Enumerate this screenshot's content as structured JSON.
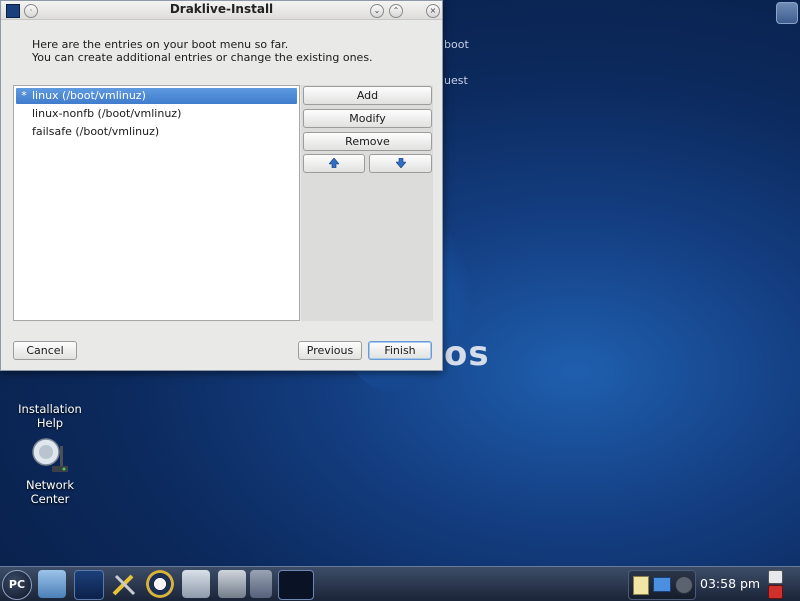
{
  "window": {
    "title": "Draklive-Install",
    "intro_line1": "Here are the entries on your boot menu so far.",
    "intro_line2": "You can create additional entries or change the existing ones."
  },
  "boot_entries": [
    {
      "marker": "*",
      "label": "linux (/boot/vmlinuz)",
      "selected": true
    },
    {
      "marker": "",
      "label": "linux-nonfb (/boot/vmlinuz)",
      "selected": false
    },
    {
      "marker": "",
      "label": "failsafe (/boot/vmlinuz)",
      "selected": false
    }
  ],
  "buttons": {
    "add": "Add",
    "modify": "Modify",
    "remove": "Remove",
    "cancel": "Cancel",
    "previous": "Previous",
    "finish": "Finish"
  },
  "desktop": {
    "bg_text_1": "boot",
    "bg_text_2": "uest",
    "brand_suffix": "os",
    "icons": [
      {
        "label_line1": "Installation",
        "label_line2": "Help"
      },
      {
        "label_line1": "Network",
        "label_line2": "Center"
      }
    ]
  },
  "taskbar": {
    "menu_label": "PC",
    "clock": "03:58 pm"
  },
  "colors": {
    "selection": "#4a86d4",
    "desktop_bg": "#0c2a5e",
    "taskbar": "#1a2438"
  }
}
